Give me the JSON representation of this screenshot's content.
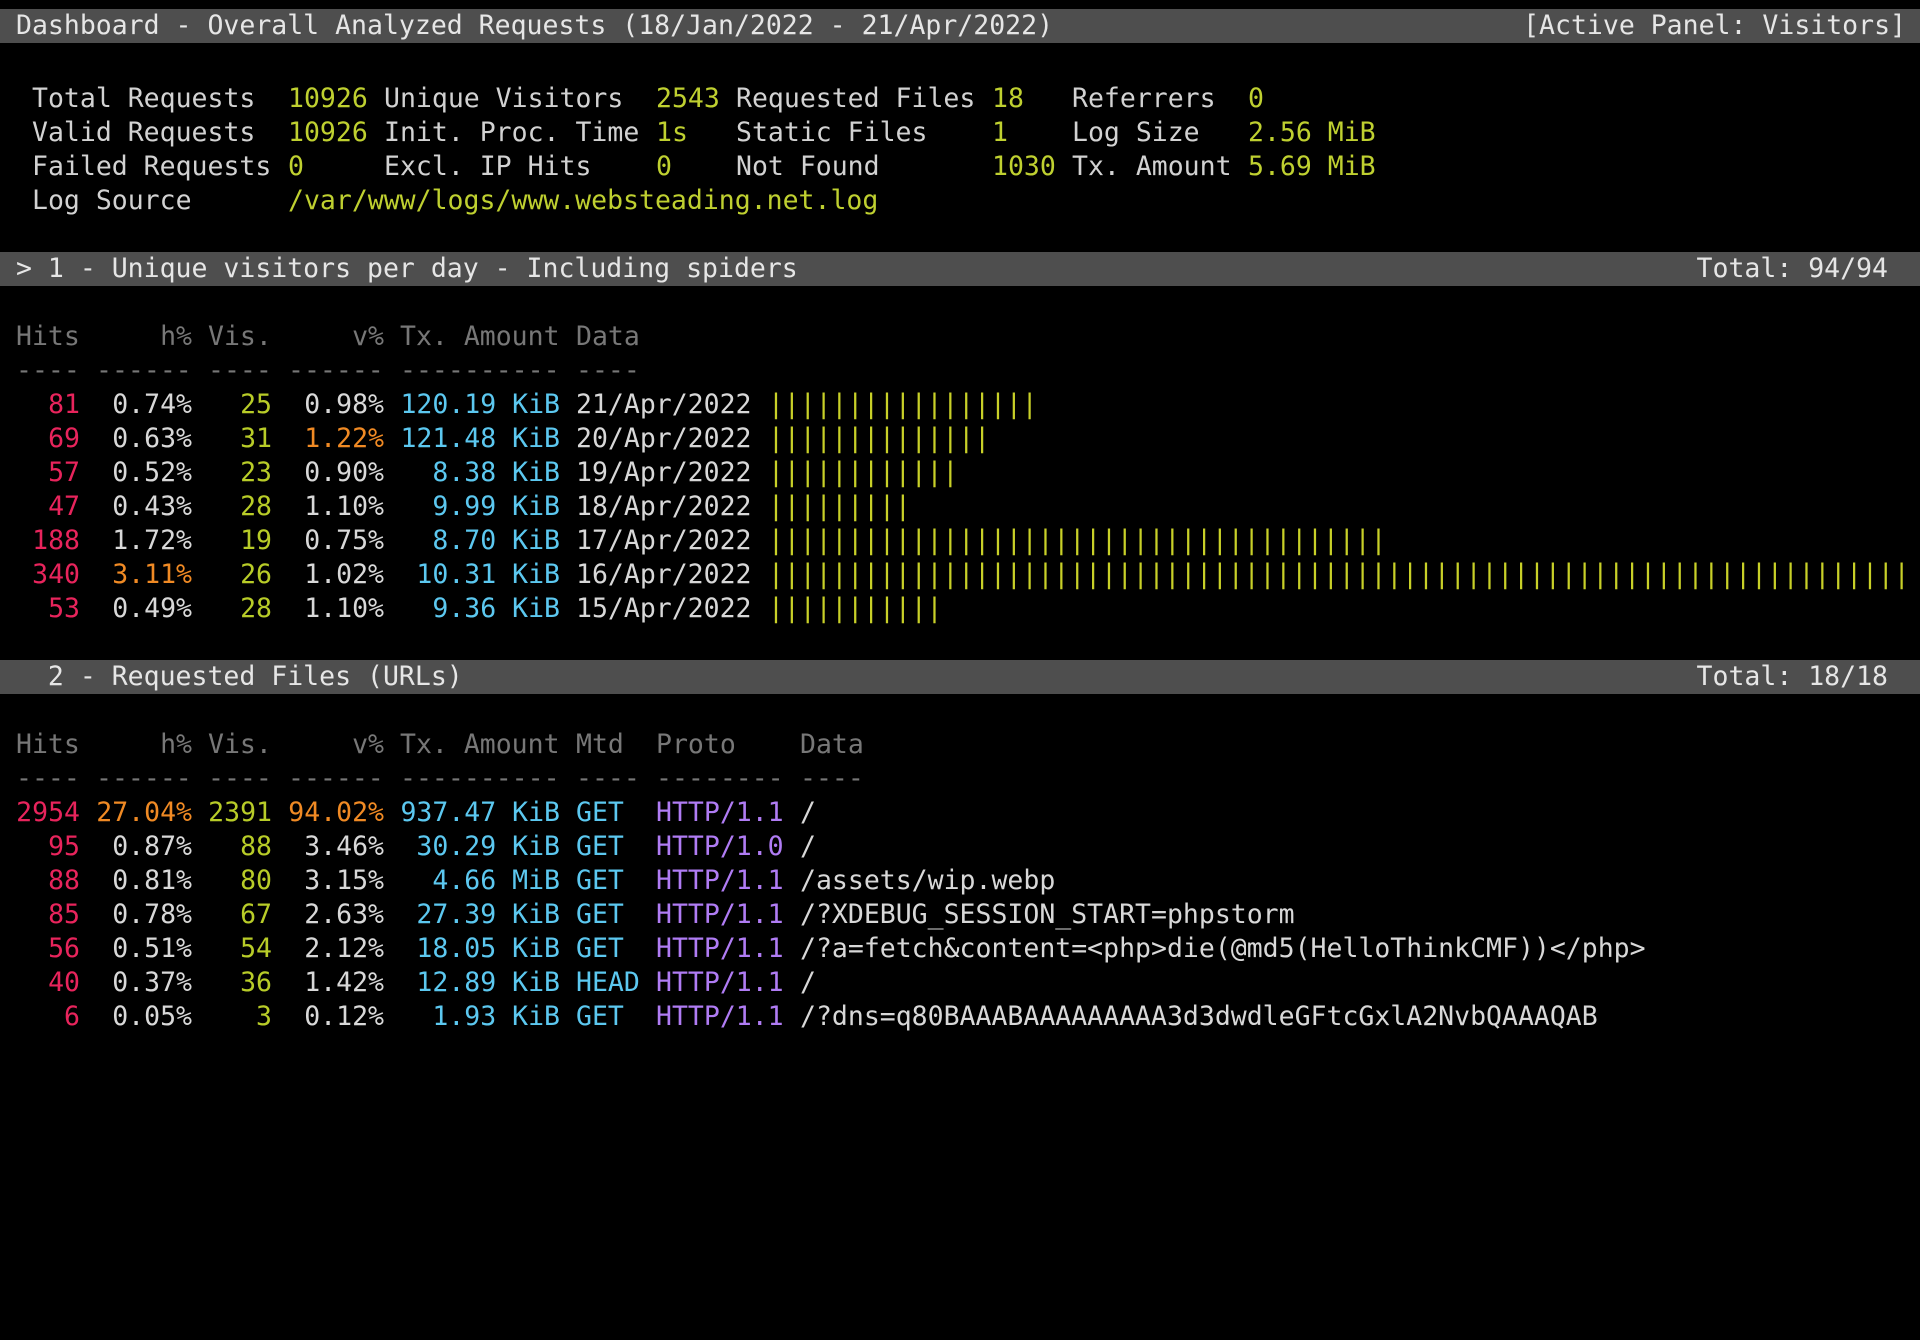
{
  "header": {
    "title": "Dashboard - Overall Analyzed Requests (18/Jan/2022 - 21/Apr/2022)",
    "active_panel": "[Active Panel: Visitors]"
  },
  "overall": {
    "total_requests_label": "Total Requests",
    "total_requests": "10926",
    "unique_visitors_label": "Unique Visitors",
    "unique_visitors": "2543",
    "requested_files_label": "Requested Files",
    "requested_files": "18",
    "referrers_label": "Referrers",
    "referrers": "0",
    "valid_requests_label": "Valid Requests",
    "valid_requests": "10926",
    "init_proc_time_label": "Init. Proc. Time",
    "init_proc_time": "1s",
    "static_files_label": "Static Files",
    "static_files": "1",
    "log_size_label": "Log Size",
    "log_size": "2.56 MiB",
    "failed_requests_label": "Failed Requests",
    "failed_requests": "0",
    "excl_ip_hits_label": "Excl. IP Hits",
    "excl_ip_hits": "0",
    "not_found_label": "Not Found",
    "not_found": "1030",
    "tx_amount_label": "Tx. Amount",
    "tx_amount": "5.69 MiB",
    "log_source_label": "Log Source",
    "log_source": "/var/www/logs/www.websteading.net.log"
  },
  "panel1": {
    "title": "> 1 - Unique visitors per day - Including spiders",
    "total": "Total: 94/94",
    "headers": {
      "hits": "Hits",
      "hpct": "h%",
      "vis": "Vis.",
      "vpct": "v%",
      "tx": "Tx. Amount",
      "data": "Data"
    },
    "separators": {
      "hits": "----",
      "hpct": "------",
      "vis": "----",
      "vpct": "------",
      "tx": "----------",
      "data": "----"
    },
    "rows": [
      {
        "hits": "81",
        "hpct": "0.74%",
        "vis": "25",
        "vpct": "0.98%",
        "tx": "120.19 KiB",
        "data": "21/Apr/2022",
        "bar": "|||||||||||||||||",
        "vpct_hl": false,
        "hpct_hl": false
      },
      {
        "hits": "69",
        "hpct": "0.63%",
        "vis": "31",
        "vpct": "1.22%",
        "tx": "121.48 KiB",
        "data": "20/Apr/2022",
        "bar": "||||||||||||||",
        "vpct_hl": true,
        "hpct_hl": false
      },
      {
        "hits": "57",
        "hpct": "0.52%",
        "vis": "23",
        "vpct": "0.90%",
        "tx": "8.38 KiB",
        "data": "19/Apr/2022",
        "bar": "||||||||||||",
        "vpct_hl": false,
        "hpct_hl": false
      },
      {
        "hits": "47",
        "hpct": "0.43%",
        "vis": "28",
        "vpct": "1.10%",
        "tx": "9.99 KiB",
        "data": "18/Apr/2022",
        "bar": "|||||||||",
        "vpct_hl": false,
        "hpct_hl": false
      },
      {
        "hits": "188",
        "hpct": "1.72%",
        "vis": "19",
        "vpct": "0.75%",
        "tx": "8.70 KiB",
        "data": "17/Apr/2022",
        "bar": "|||||||||||||||||||||||||||||||||||||||",
        "vpct_hl": false,
        "hpct_hl": false
      },
      {
        "hits": "340",
        "hpct": "3.11%",
        "vis": "26",
        "vpct": "1.02%",
        "tx": "10.31 KiB",
        "data": "16/Apr/2022",
        "bar": "||||||||||||||||||||||||||||||||||||||||||||||||||||||||||||||||||||||||",
        "vpct_hl": false,
        "hpct_hl": true
      },
      {
        "hits": "53",
        "hpct": "0.49%",
        "vis": "28",
        "vpct": "1.10%",
        "tx": "9.36 KiB",
        "data": "15/Apr/2022",
        "bar": "|||||||||||",
        "vpct_hl": false,
        "hpct_hl": false
      }
    ]
  },
  "panel2": {
    "title": "  2 - Requested Files (URLs)",
    "total": "Total: 18/18",
    "headers": {
      "hits": "Hits",
      "hpct": "h%",
      "vis": "Vis.",
      "vpct": "v%",
      "tx": "Tx. Amount",
      "mtd": "Mtd",
      "proto": "Proto",
      "data": "Data"
    },
    "separators": {
      "hits": "----",
      "hpct": "------",
      "vis": "----",
      "vpct": "------",
      "tx": "----------",
      "mtd": "----",
      "proto": "--------",
      "data": "----"
    },
    "rows": [
      {
        "hits": "2954",
        "hpct": "27.04%",
        "vis": "2391",
        "vpct": "94.02%",
        "tx": "937.47 KiB",
        "mtd": "GET",
        "proto": "HTTP/1.1",
        "data": "/",
        "hl": true
      },
      {
        "hits": "95",
        "hpct": "0.87%",
        "vis": "88",
        "vpct": "3.46%",
        "tx": "30.29 KiB",
        "mtd": "GET",
        "proto": "HTTP/1.0",
        "data": "/",
        "hl": false
      },
      {
        "hits": "88",
        "hpct": "0.81%",
        "vis": "80",
        "vpct": "3.15%",
        "tx": "4.66 MiB",
        "mtd": "GET",
        "proto": "HTTP/1.1",
        "data": "/assets/wip.webp",
        "hl": false
      },
      {
        "hits": "85",
        "hpct": "0.78%",
        "vis": "67",
        "vpct": "2.63%",
        "tx": "27.39 KiB",
        "mtd": "GET",
        "proto": "HTTP/1.1",
        "data": "/?XDEBUG_SESSION_START=phpstorm",
        "hl": false
      },
      {
        "hits": "56",
        "hpct": "0.51%",
        "vis": "54",
        "vpct": "2.12%",
        "tx": "18.05 KiB",
        "mtd": "GET",
        "proto": "HTTP/1.1",
        "data": "/?a=fetch&content=<php>die(@md5(HelloThinkCMF))</php>",
        "hl": false
      },
      {
        "hits": "40",
        "hpct": "0.37%",
        "vis": "36",
        "vpct": "1.42%",
        "tx": "12.89 KiB",
        "mtd": "HEAD",
        "proto": "HTTP/1.1",
        "data": "/",
        "hl": false
      },
      {
        "hits": "6",
        "hpct": "0.05%",
        "vis": "3",
        "vpct": "0.12%",
        "tx": "1.93 KiB",
        "mtd": "GET",
        "proto": "HTTP/1.1",
        "data": "/?dns=q80BAAABAAAAAAAAA3d3dwdleGFtcGxlA2NvbQAAAQAB",
        "hl": false
      }
    ]
  }
}
